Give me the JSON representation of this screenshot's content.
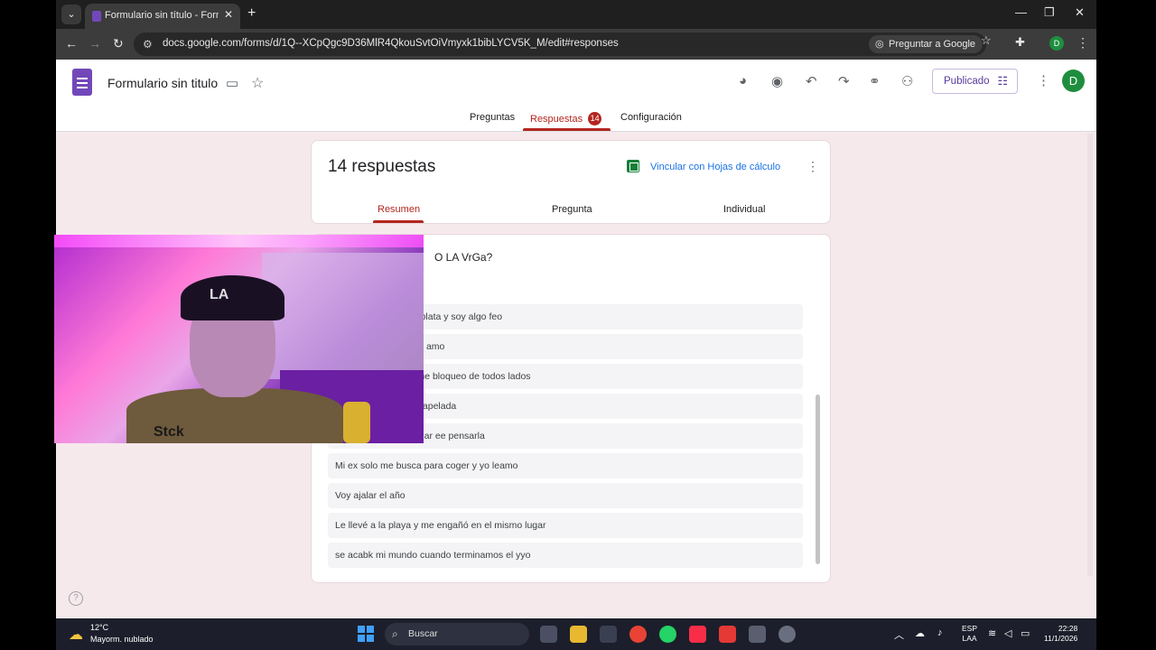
{
  "browser": {
    "tab_title": "Formulario sin título - Formula",
    "url": "docs.google.com/forms/d/1Q--XCpQgc9D36MlR4QkouSvtOiVmyxk1bibLYCV5K_M/edit#responses",
    "ask_google_label": "Preguntar a Google",
    "profile_initial": "D"
  },
  "forms": {
    "doc_title": "Formulario sin titulo",
    "publish_label": "Publicado",
    "user_initial": "D",
    "tabs": [
      {
        "label": "Preguntas"
      },
      {
        "label": "Respuestas",
        "badge": "14"
      },
      {
        "label": "Configuración"
      }
    ]
  },
  "summary": {
    "count_label": "14 respuestas",
    "sheets_link": "Vincular con Hojas de cálculo",
    "subtabs": [
      "Resumen",
      "Pregunta",
      "Individual"
    ]
  },
  "question": {
    "title_partial": "O LA VrGa?",
    "responses": [
      "er novia si no tengo plata y soy algo feo",
      "le alejamiento y yo la amo",
      "le que la amo si ya me bloqueo de todos lados",
      "er para hablarle a unapelada",
      "extraño no puedo dejar ee pensarla",
      "Mi ex solo me busca para coger y yo leamo",
      "Voy ajalar el año",
      "Le llevé a la playa y me engañó en el mismo lugar",
      "se acabk mi mundo cuando terminamos el yyo"
    ]
  },
  "webcam": {
    "cap_text": "LA",
    "jacket_text": "Stck"
  },
  "taskbar": {
    "temperature": "12°C",
    "condition": "Mayorm. nublado",
    "search_placeholder": "Buscar",
    "lang_top": "ESP",
    "lang_bottom": "LAA",
    "time": "22:28",
    "date": "11/1/2026"
  }
}
